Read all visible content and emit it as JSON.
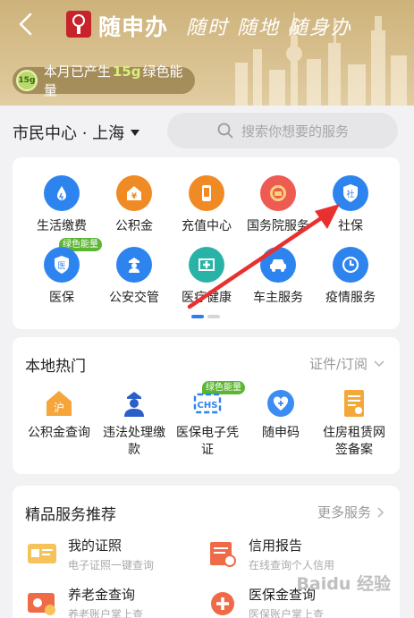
{
  "header": {
    "app_name": "随申办",
    "slogan": "随时 随地 随身办",
    "energy": {
      "badge": "15g",
      "prefix": "本月已产生",
      "amount": "15g",
      "suffix": "绿色能量"
    }
  },
  "location": {
    "label": "市民中心 · 上海"
  },
  "search": {
    "placeholder": "搜索你想要的服务"
  },
  "services": [
    {
      "label": "生活缴费",
      "icon": "water-drop-icon",
      "color": "#2e84ef"
    },
    {
      "label": "公积金",
      "icon": "yuan-house-icon",
      "color": "#f08a24"
    },
    {
      "label": "充值中心",
      "icon": "phone-icon",
      "color": "#f08a24"
    },
    {
      "label": "国务院服务",
      "icon": "national-emblem-icon",
      "color": "#ee5b52"
    },
    {
      "label": "社保",
      "icon": "shield-icon",
      "color": "#2e84ef",
      "glyph": "社"
    },
    {
      "label": "医保",
      "icon": "shield-icon",
      "color": "#2e84ef",
      "glyph": "医",
      "tag": "绿色能量"
    },
    {
      "label": "公安交管",
      "icon": "police-icon",
      "color": "#2e84ef"
    },
    {
      "label": "医疗健康",
      "icon": "medical-cross-icon",
      "color": "#29b3a6"
    },
    {
      "label": "车主服务",
      "icon": "car-icon",
      "color": "#2e84ef"
    },
    {
      "label": "疫情服务",
      "icon": "clock-icon",
      "color": "#2e84ef"
    }
  ],
  "hot": {
    "title": "本地热门",
    "link": "证件/订阅",
    "items": [
      {
        "line1": "公积金查询",
        "line2": "",
        "icon": "house-icon"
      },
      {
        "line1": "违法处理缴",
        "line2": "款",
        "icon": "police-officer-icon"
      },
      {
        "line1": "医保电子凭",
        "line2": "证",
        "icon": "chs-icon",
        "tag": "绿色能量"
      },
      {
        "line1": "随申码",
        "line2": "",
        "icon": "heart-plus-icon"
      },
      {
        "line1": "住房租赁网",
        "line2": "签备案",
        "icon": "document-icon"
      }
    ]
  },
  "recommend": {
    "title": "精品服务推荐",
    "link": "更多服务",
    "items": [
      {
        "title": "我的证照",
        "sub": "电子证照一键查询",
        "icon": "id-card-icon"
      },
      {
        "title": "信用报告",
        "sub": "在线查询个人信用",
        "icon": "report-icon"
      },
      {
        "title": "养老金查询",
        "sub": "养老账户掌上查",
        "icon": "pension-icon"
      },
      {
        "title": "医保金查询",
        "sub": "医保账户掌上查",
        "icon": "medical-card-icon"
      }
    ]
  },
  "watermark": "Baidu 经验",
  "colors": {
    "header": "#d2b883",
    "accent": "#2d7ff0",
    "green_tag": "#5cb533",
    "annotation_arrow": "#e8312f"
  }
}
